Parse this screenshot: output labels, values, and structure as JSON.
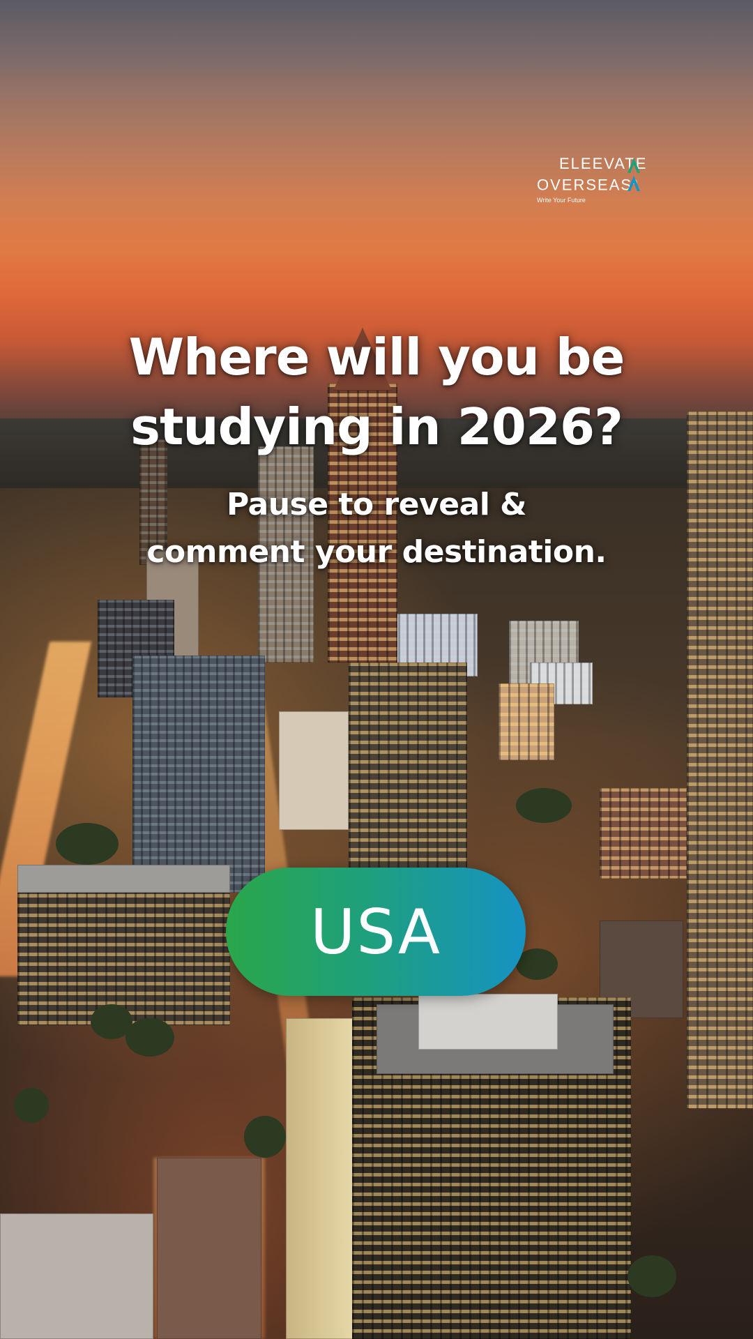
{
  "brand": {
    "line1": "ELEEVATE",
    "line2": "OVERSEAS",
    "registered": "®",
    "tagline": "Write Your Future"
  },
  "headline": {
    "line1": "Where will you be",
    "line2": "studying in 2026?"
  },
  "subline": {
    "line1": "Pause to reveal &",
    "line2": "comment your destination."
  },
  "reveal": {
    "destination": "USA"
  },
  "colors": {
    "pill_start": "#2aa64a",
    "pill_end": "#1593c4",
    "text": "#ffffff"
  },
  "background": {
    "description_icon": "city-skyline-sunset"
  }
}
